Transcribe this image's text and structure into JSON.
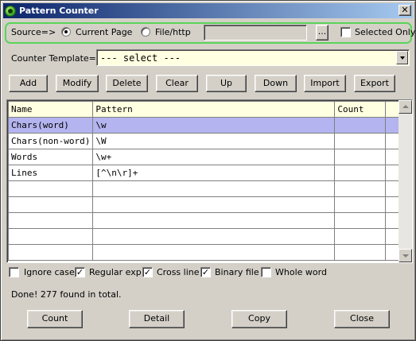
{
  "window": {
    "title": "Pattern Counter",
    "close_label": "✕"
  },
  "source": {
    "label": "Source=>",
    "options": [
      "Current Page",
      "File/http"
    ],
    "selected": "Current Page",
    "path_value": "",
    "browse_label": "...",
    "selected_only_label": "Selected Only",
    "selected_only_checked": false
  },
  "template": {
    "label": "Counter Template=>",
    "value": "--- select ---"
  },
  "toolbar": [
    "Add",
    "Modify",
    "Delete",
    "Clear",
    "Up",
    "Down",
    "Import",
    "Export"
  ],
  "table": {
    "headers": [
      "Name",
      "Pattern",
      "Count"
    ],
    "rows": [
      [
        "Chars(word)",
        "\\w",
        ""
      ],
      [
        "Chars(non-word)",
        "\\W",
        ""
      ],
      [
        "Words",
        "\\w+",
        ""
      ],
      [
        "Lines",
        "[^\\n\\r]+",
        ""
      ]
    ],
    "selected_row": 0,
    "empty_rows": 5
  },
  "options": [
    {
      "label": "Ignore case",
      "checked": false
    },
    {
      "label": "Regular exp",
      "checked": true
    },
    {
      "label": "Cross line",
      "checked": true
    },
    {
      "label": "Binary file",
      "checked": true
    },
    {
      "label": "Whole word",
      "checked": false
    }
  ],
  "status": "Done! 277 found in total.",
  "actions": [
    "Count",
    "Detail",
    "Copy",
    "Close"
  ],
  "colors": {
    "title_gradient_start": "#0a246a",
    "title_gradient_end": "#a6caf0",
    "source_group_border": "#5ad45a",
    "selected_row": "#b4b4f0",
    "header_bg": "#ffffe1",
    "face": "#d4d0c8"
  }
}
